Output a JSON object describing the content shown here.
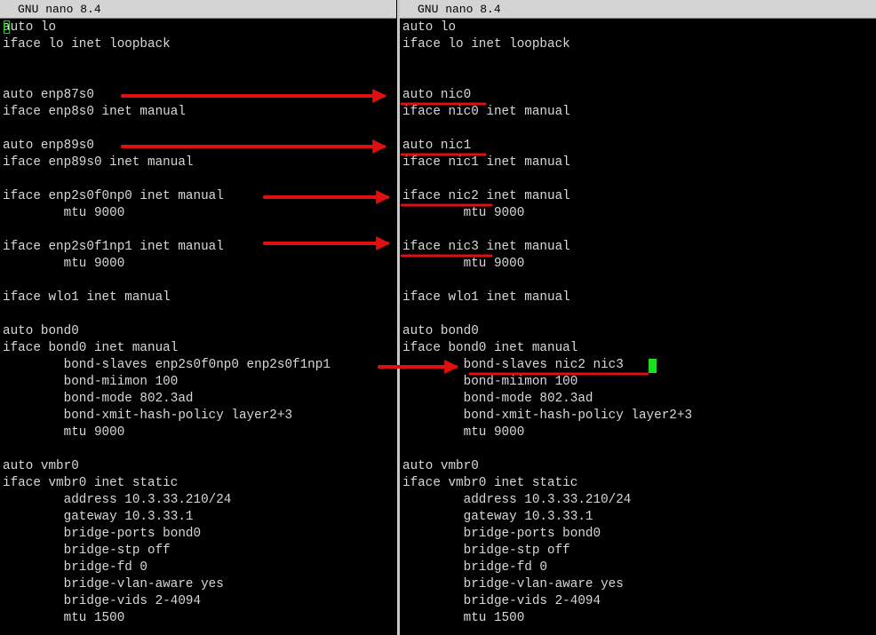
{
  "colors": {
    "background": "#000000",
    "text": "#d8d8d8",
    "titlebar_bg": "#d4d4d4",
    "annotation": "#e01010",
    "cursor": "#1edc1e"
  },
  "left_pane": {
    "title": "GNU nano 8.4",
    "lines": [
      "auto lo",
      "iface lo inet loopback",
      "",
      "",
      "auto enp87s0",
      "iface enp8s0 inet manual",
      "",
      "auto enp89s0",
      "iface enp89s0 inet manual",
      "",
      "iface enp2s0f0np0 inet manual",
      "        mtu 9000",
      "",
      "iface enp2s0f1np1 inet manual",
      "        mtu 9000",
      "",
      "iface wlo1 inet manual",
      "",
      "auto bond0",
      "iface bond0 inet manual",
      "        bond-slaves enp2s0f0np0 enp2s0f1np1",
      "        bond-miimon 100",
      "        bond-mode 802.3ad",
      "        bond-xmit-hash-policy layer2+3",
      "        mtu 9000",
      "",
      "auto vmbr0",
      "iface vmbr0 inet static",
      "        address 10.3.33.210/24",
      "        gateway 10.3.33.1",
      "        bridge-ports bond0",
      "        bridge-stp off",
      "        bridge-fd 0",
      "        bridge-vlan-aware yes",
      "        bridge-vids 2-4094",
      "        mtu 1500"
    ]
  },
  "right_pane": {
    "title": "GNU nano 8.4",
    "lines": [
      "auto lo",
      "iface lo inet loopback",
      "",
      "",
      "auto nic0",
      "iface nic0 inet manual",
      "",
      "auto nic1",
      "iface nic1 inet manual",
      "",
      "iface nic2 inet manual",
      "        mtu 9000",
      "",
      "iface nic3 inet manual",
      "        mtu 9000",
      "",
      "iface wlo1 inet manual",
      "",
      "auto bond0",
      "iface bond0 inet manual",
      "        bond-slaves nic2 nic3",
      "        bond-miimon 100",
      "        bond-mode 802.3ad",
      "        bond-xmit-hash-policy layer2+3",
      "        mtu 9000",
      "",
      "auto vmbr0",
      "iface vmbr0 inet static",
      "        address 10.3.33.210/24",
      "        gateway 10.3.33.1",
      "        bridge-ports bond0",
      "        bridge-stp off",
      "        bridge-fd 0",
      "        bridge-vlan-aware yes",
      "        bridge-vids 2-4094",
      "        mtu 1500"
    ]
  }
}
